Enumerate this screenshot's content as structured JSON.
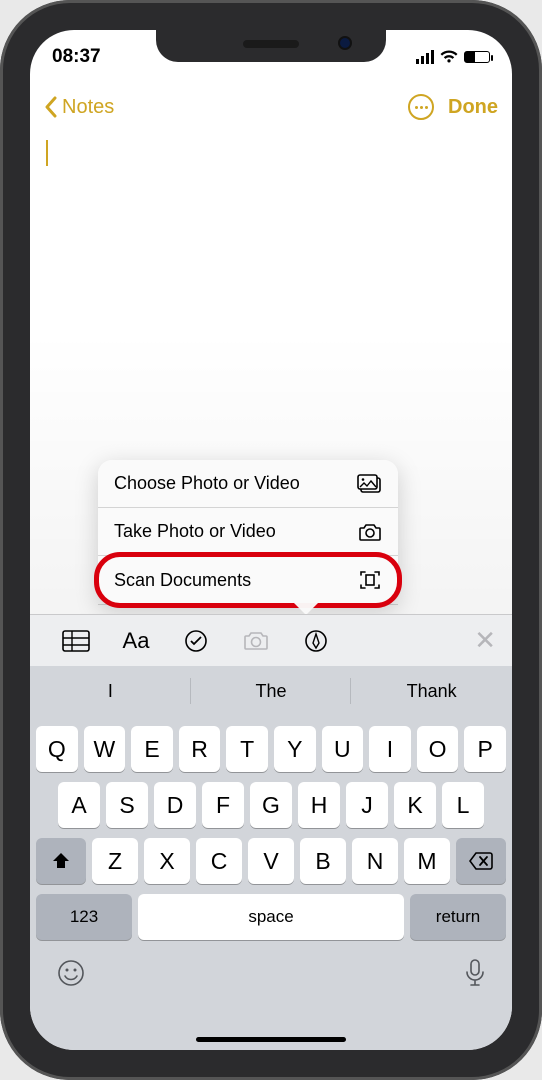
{
  "status": {
    "time": "08:37"
  },
  "nav": {
    "back_label": "Notes",
    "done_label": "Done"
  },
  "menu": {
    "items": [
      {
        "label": "Choose Photo or Video"
      },
      {
        "label": "Take Photo or Video"
      },
      {
        "label": "Scan Documents"
      }
    ]
  },
  "toolbar": {
    "aa": "Aa"
  },
  "keyboard": {
    "predict": [
      "I",
      "The",
      "Thank"
    ],
    "row1": [
      "Q",
      "W",
      "E",
      "R",
      "T",
      "Y",
      "U",
      "I",
      "O",
      "P"
    ],
    "row2": [
      "A",
      "S",
      "D",
      "F",
      "G",
      "H",
      "J",
      "K",
      "L"
    ],
    "row3": [
      "Z",
      "X",
      "C",
      "V",
      "B",
      "N",
      "M"
    ],
    "numToggle": "123",
    "space": "space",
    "ret": "return"
  }
}
